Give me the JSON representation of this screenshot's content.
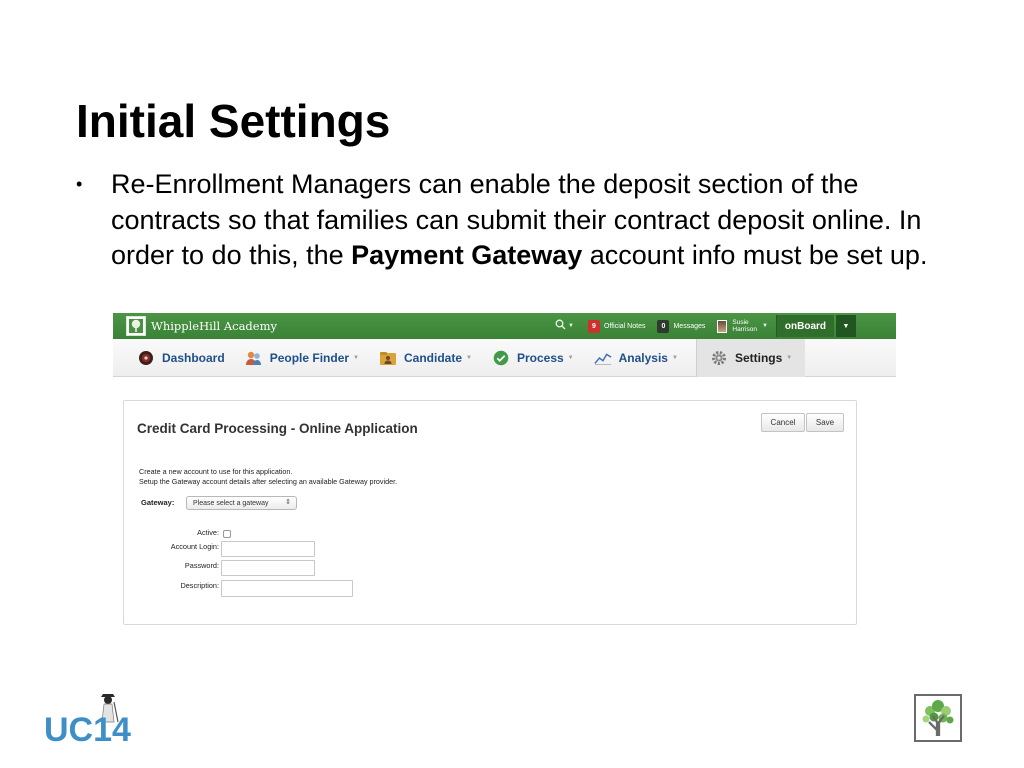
{
  "slide": {
    "title": "Initial Settings",
    "bullet_part1": "Re-Enrollment Managers can enable the deposit section of the contracts so that families can submit their contract deposit online. In order to do this, the ",
    "bullet_bold": "Payment Gateway",
    "bullet_part2": " account info must be set up."
  },
  "topbar": {
    "brand": "WhippleHill Academy",
    "notes_count": "9",
    "notes_label": "Official Notes",
    "messages_count": "0",
    "messages_label": "Messages",
    "user_first": "Susie",
    "user_last": "Harrison",
    "onboard_label": "onBoard"
  },
  "navbar": {
    "items": [
      {
        "label": "Dashboard",
        "icon": "dashboard-icon"
      },
      {
        "label": "People Finder",
        "icon": "people-icon"
      },
      {
        "label": "Candidate",
        "icon": "candidate-folder-icon"
      },
      {
        "label": "Process",
        "icon": "check-circle-icon"
      },
      {
        "label": "Analysis",
        "icon": "line-chart-icon"
      },
      {
        "label": "Settings",
        "icon": "gear-icon"
      }
    ]
  },
  "form": {
    "title": "Credit Card Processing - Online Application",
    "cancel_label": "Cancel",
    "save_label": "Save",
    "desc_line1": "Create a new account to use for this application.",
    "desc_line2": "Setup the Gateway account details after selecting an available Gateway provider.",
    "gateway_label": "Gateway:",
    "gateway_value": "Please select a gateway",
    "active_label": "Active:",
    "active_checked": false,
    "login_label": "Account Login:",
    "login_value": "",
    "password_label": "Password:",
    "password_value": "",
    "description_label": "Description:",
    "description_value": ""
  },
  "footer": {
    "conference_logo_text": "UC14"
  },
  "colors": {
    "topbar_green": "#3f8a3b",
    "nav_link_blue": "#1f4f8a",
    "badge_red": "#d0302b",
    "uc14_blue": "#3f8fc7"
  }
}
